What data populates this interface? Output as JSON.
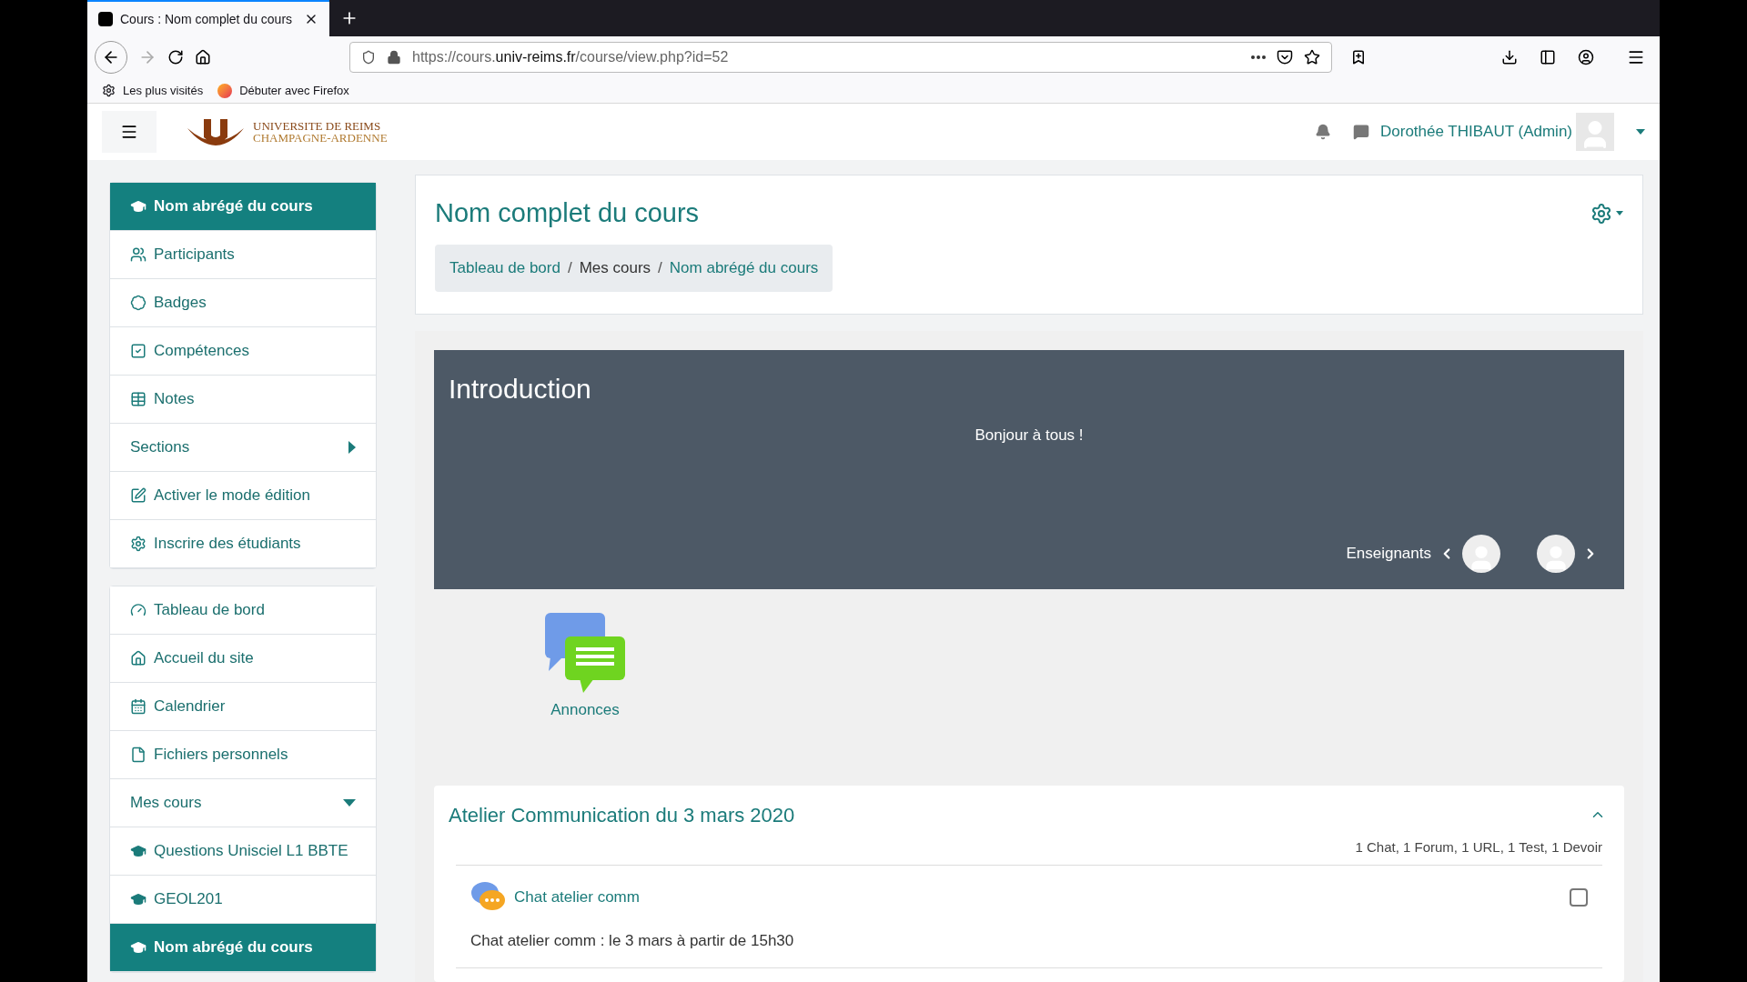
{
  "browser": {
    "tab": {
      "title": "Cours : Nom complet du cours"
    },
    "url": {
      "scheme": "https://cours.",
      "domain": "univ-reims.fr",
      "path": "/course/view.php?id=52"
    },
    "bookmarks": [
      "Les plus visités",
      "Débuter avec Firefox"
    ]
  },
  "header": {
    "logo": {
      "line1": "UNIVERSITE DE REIMS",
      "line2": "CHAMPAGNE-ARDENNE"
    },
    "user": "Dorothée THIBAUT (Admin)"
  },
  "sidebar": {
    "groups": [
      {
        "items": [
          {
            "label": "Nom abrégé du cours",
            "selected": true
          },
          {
            "label": "Participants",
            "selected": false
          },
          {
            "label": "Badges",
            "selected": false
          },
          {
            "label": "Compétences",
            "selected": false
          },
          {
            "label": "Notes",
            "selected": false
          },
          {
            "label": "Sections",
            "selected": false,
            "expanded": false
          },
          {
            "label": "Activer le mode édition",
            "selected": false
          },
          {
            "label": "Inscrire des étudiants",
            "selected": false
          }
        ]
      },
      {
        "items": [
          {
            "label": "Tableau de bord",
            "selected": false
          },
          {
            "label": "Accueil du site",
            "selected": false
          },
          {
            "label": "Calendrier",
            "selected": false
          },
          {
            "label": "Fichiers personnels",
            "selected": false
          },
          {
            "label": "Mes cours",
            "selected": false,
            "expanded": true
          },
          {
            "label": "Questions Unisciel L1 BBTE",
            "selected": false
          },
          {
            "label": "GEOL201",
            "selected": false
          },
          {
            "label": "Nom abrégé du cours",
            "selected": true
          }
        ]
      }
    ]
  },
  "page_header": {
    "title": "Nom complet du cours",
    "breadcrumb_separator": "/",
    "breadcrumb": [
      {
        "label": "Tableau de bord",
        "link": true
      },
      {
        "label": "Mes cours",
        "link": false
      },
      {
        "label": "Nom abrégé du cours",
        "link": true
      }
    ]
  },
  "intro": {
    "title": "Introduction",
    "message": "Bonjour à tous !",
    "teachers_label": "Enseignants"
  },
  "announcements": {
    "label": "Annonces"
  },
  "section": {
    "title": "Atelier Communication du 3 mars 2020",
    "expanded": true,
    "summary": "1 Chat, 1 Forum, 1 URL, 1 Test, 1 Devoir",
    "activities": [
      {
        "name": "Chat atelier comm",
        "description": "Chat atelier comm : le 3 mars à partir de 15h30",
        "checked": false
      }
    ]
  }
}
